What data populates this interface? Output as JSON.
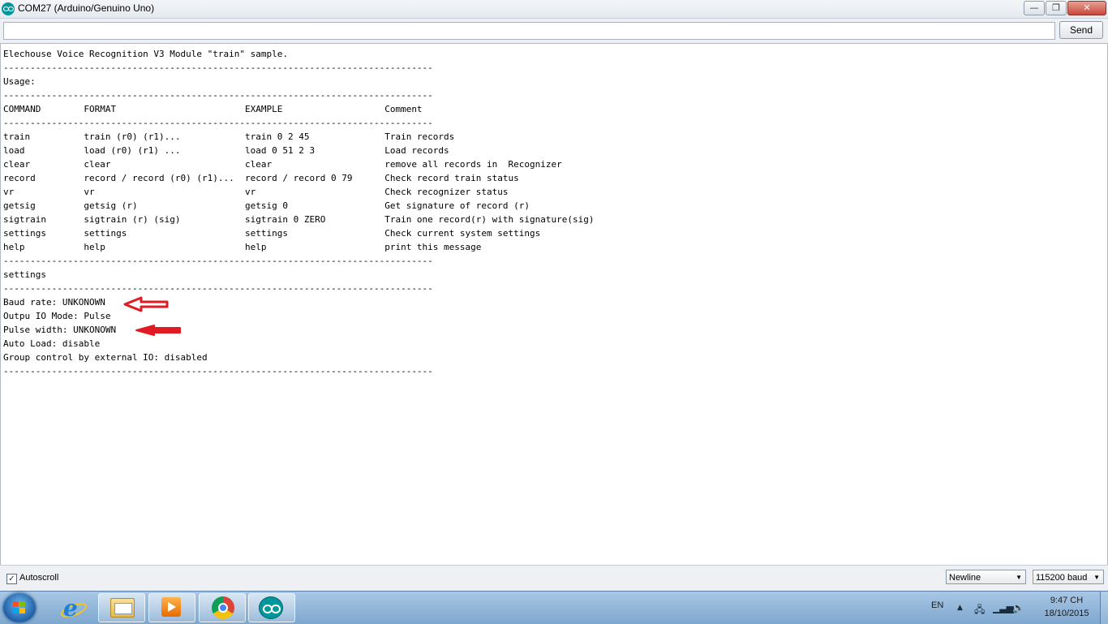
{
  "window": {
    "title": "COM27 (Arduino/Genuino Uno)",
    "minimize_glyph": "—",
    "maximize_glyph": "❐",
    "close_glyph": "✕"
  },
  "send": {
    "input_value": "",
    "button_label": "Send"
  },
  "serial_output": {
    "text": "Elechouse Voice Recognition V3 Module \"train\" sample.\n--------------------------------------------------------------------------------\nUsage:\n--------------------------------------------------------------------------------\nCOMMAND        FORMAT                        EXAMPLE                   Comment\n--------------------------------------------------------------------------------\ntrain          train (r0) (r1)...            train 0 2 45              Train records\nload           load (r0) (r1) ...            load 0 51 2 3             Load records\nclear          clear                         clear                     remove all records in  Recognizer\nrecord         record / record (r0) (r1)...  record / record 0 79      Check record train status\nvr             vr                            vr                        Check recognizer status\ngetsig         getsig (r)                    getsig 0                  Get signature of record (r)\nsigtrain       sigtrain (r) (sig)            sigtrain 0 ZERO           Train one record(r) with signature(sig)\nsettings       settings                      settings                  Check current system settings\nhelp           help                          help                      print this message\n--------------------------------------------------------------------------------\nsettings\n--------------------------------------------------------------------------------\nBaud rate: UNKONOWN\nOutpu IO Mode: Pulse\nPulse width: UNKONOWN\nAuto Load: disable\nGroup control by external IO: disabled\n--------------------------------------------------------------------------------"
  },
  "bottom_bar": {
    "autoscroll_checked": "✓",
    "autoscroll_label": "Autoscroll",
    "line_ending": "Newline",
    "baud_rate": "115200 baud"
  },
  "taskbar": {
    "language": "EN",
    "clock_time": "9:47 CH",
    "clock_date": "18/10/2015"
  },
  "colors": {
    "annotation_arrow": "#e01b24",
    "arduino_teal": "#00979c"
  },
  "icons": [
    "arduino-icon",
    "windows-start-icon",
    "internet-explorer-icon",
    "file-explorer-icon",
    "media-player-icon",
    "chrome-icon",
    "arduino-taskbar-icon",
    "tray-chevron-icon",
    "network-icon",
    "signal-icon",
    "volume-icon"
  ]
}
